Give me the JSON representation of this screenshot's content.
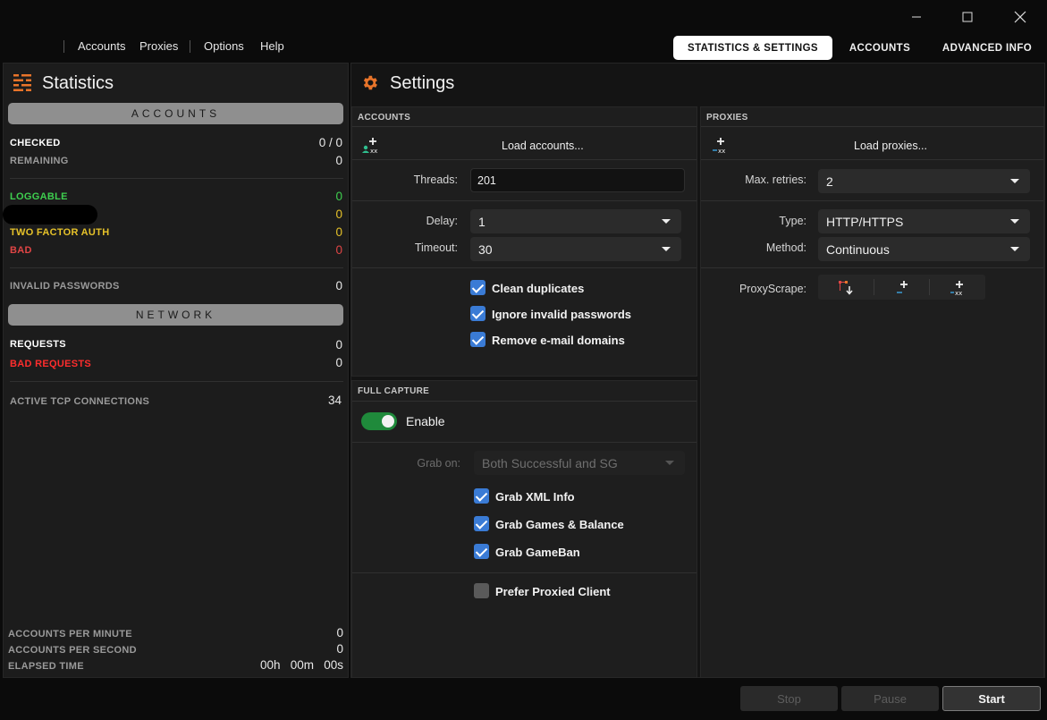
{
  "menu": {
    "items": [
      "Accounts",
      "Proxies",
      "Options",
      "Help"
    ]
  },
  "tabs": [
    "STATISTICS & SETTINGS",
    "ACCOUNTS",
    "ADVANCED INFO"
  ],
  "statistics": {
    "title": "Statistics",
    "accounts_header": "ACCOUNTS",
    "checked_label": "CHECKED",
    "checked_value": "0 / 0",
    "remaining_label": "REMAINING",
    "remaining_value": "0",
    "loggable_label": "LOGGABLE",
    "loggable_value": "0",
    "redacted_value": "0",
    "two_factor_label": "TWO FACTOR AUTH",
    "two_factor_value": "0",
    "bad_label": "BAD",
    "bad_value": "0",
    "invalid_label": "INVALID PASSWORDS",
    "invalid_value": "0",
    "network_header": "NETWORK",
    "requests_label": "REQUESTS",
    "requests_value": "0",
    "bad_requests_label": "BAD REQUESTS",
    "bad_requests_value": "0",
    "tcp_label": "ACTIVE TCP CONNECTIONS",
    "tcp_value": "34",
    "apm_label": "ACCOUNTS PER MINUTE",
    "apm_value": "0",
    "aps_label": "ACCOUNTS PER SECOND",
    "aps_value": "0",
    "elapsed_label": "ELAPSED TIME",
    "elapsed_value": "00h   00m   00s"
  },
  "settings": {
    "title": "Settings",
    "accounts": {
      "title": "ACCOUNTS",
      "load_label": "Load accounts...",
      "threads_label": "Threads:",
      "threads_value": "201",
      "delay_label": "Delay:",
      "delay_value": "1",
      "timeout_label": "Timeout:",
      "timeout_value": "30",
      "checkboxes": [
        "Clean duplicates",
        "Ignore invalid passwords",
        "Remove e-mail domains"
      ]
    },
    "full_capture": {
      "title": "FULL CAPTURE",
      "enable_label": "Enable",
      "grab_on_label": "Grab on:",
      "grab_on_value": "Both Successful and SG",
      "checkboxes": [
        "Grab XML Info",
        "Grab Games & Balance",
        "Grab GameBan"
      ],
      "prefer_label": "Prefer Proxied Client"
    },
    "proxies": {
      "title": "PROXIES",
      "load_label": "Load proxies...",
      "retries_label": "Max. retries:",
      "retries_value": "2",
      "type_label": "Type:",
      "type_value": "HTTP/HTTPS",
      "method_label": "Method:",
      "method_value": "Continuous",
      "proxyscrape_label": "ProxyScrape:"
    }
  },
  "buttons": {
    "stop": "Stop",
    "pause": "Pause",
    "start": "Start"
  },
  "colors": {
    "accent": "#e8742a",
    "green": "#3ecf4f",
    "yellow": "#e6c229",
    "red": "#e04545",
    "checkbox": "#3a7bd5",
    "toggle": "#1f8a3b"
  }
}
